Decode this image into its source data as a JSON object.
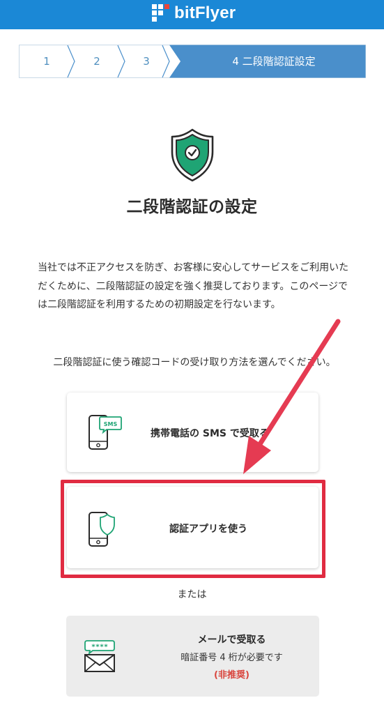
{
  "header": {
    "logo_text": "bitFlyer",
    "background": "#1b88d6"
  },
  "stepper": {
    "steps": [
      {
        "label": "1",
        "active": false
      },
      {
        "label": "2",
        "active": false
      },
      {
        "label": "3",
        "active": false
      },
      {
        "label": "4 二段階認証設定",
        "active": true
      }
    ],
    "active_color": "#4a8fcb"
  },
  "main": {
    "shield_icon": "shield-check-icon",
    "title": "二段階認証の設定",
    "intro": "当社では不正アクセスを防ぎ、お客様に安心してサービスをご利用いただくために、二段階認証の設定を強く推奨しております。このページでは二段階認証を利用するための初期設定を行ないます。",
    "instruction": "二段階認証に使う確認コードの受け取り方法を選んでください。"
  },
  "options": {
    "sms": {
      "label": "携帯電話の SMS で受取る",
      "icon": "phone-sms-icon",
      "icon_text": "SMS"
    },
    "app": {
      "label": "認証アプリを使う",
      "icon": "phone-shield-icon"
    },
    "or_text": "または",
    "mail": {
      "label": "メールで受取る",
      "note": "暗証番号 4 桁が必要です",
      "warning": "(非推奨)",
      "icon": "mail-password-icon",
      "icon_text": "****"
    }
  },
  "colors": {
    "accent_green": "#1fa474",
    "annotation_red": "#e02b41",
    "warning_red": "#d9453d"
  }
}
